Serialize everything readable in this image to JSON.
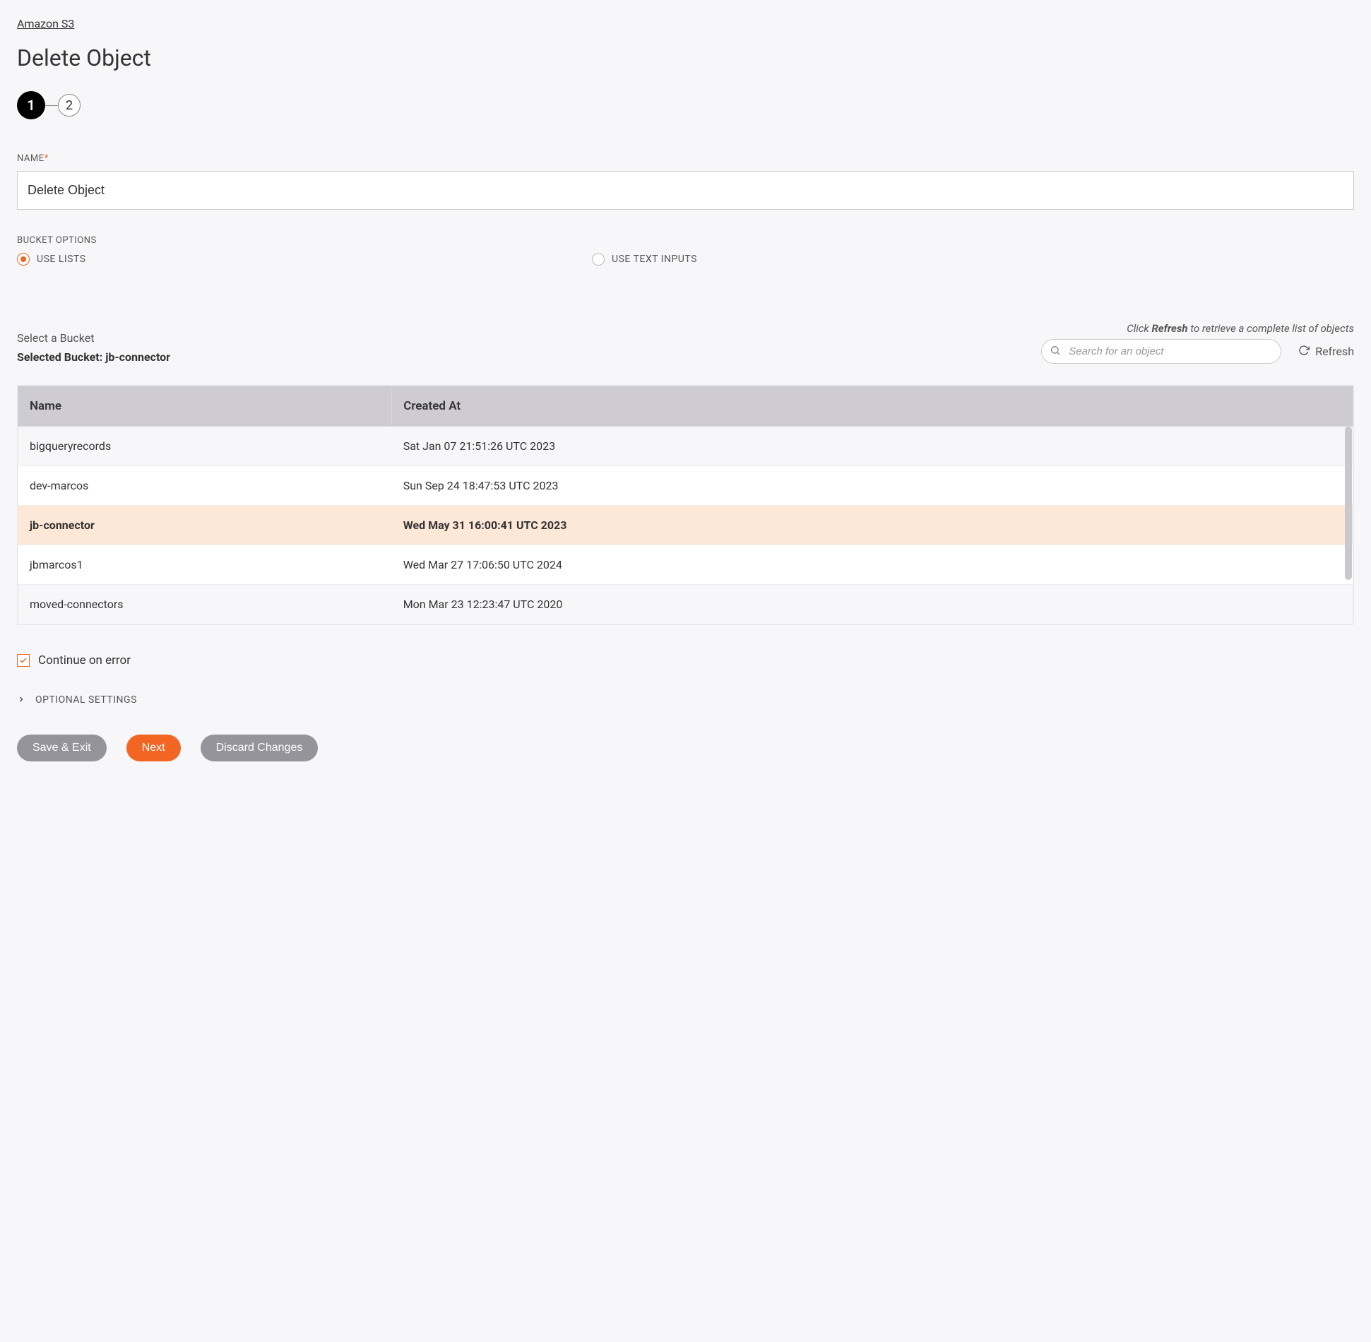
{
  "breadcrumb": "Amazon S3",
  "page_title": "Delete Object",
  "stepper": {
    "step1": "1",
    "step2": "2"
  },
  "name_field": {
    "label": "NAME",
    "value": "Delete Object"
  },
  "bucket_options": {
    "label": "BUCKET OPTIONS",
    "use_lists": "USE LISTS",
    "use_text": "USE TEXT INPUTS"
  },
  "select_bucket_label": "Select a Bucket",
  "selected_bucket_prefix": "Selected Bucket: ",
  "selected_bucket_name": "jb-connector",
  "hint_prefix": "Click ",
  "hint_bold": "Refresh",
  "hint_suffix": " to retrieve a complete list of objects",
  "search": {
    "placeholder": "Search for an object"
  },
  "refresh_label": "Refresh",
  "table": {
    "col_name": "Name",
    "col_created": "Created At",
    "rows": [
      {
        "name": "bigqueryrecords",
        "created": "Sat Jan 07 21:51:26 UTC 2023",
        "selected": false
      },
      {
        "name": "dev-marcos",
        "created": "Sun Sep 24 18:47:53 UTC 2023",
        "selected": false
      },
      {
        "name": "jb-connector",
        "created": "Wed May 31 16:00:41 UTC 2023",
        "selected": true
      },
      {
        "name": "jbmarcos1",
        "created": "Wed Mar 27 17:06:50 UTC 2024",
        "selected": false
      },
      {
        "name": "moved-connectors",
        "created": "Mon Mar 23 12:23:47 UTC 2020",
        "selected": false
      }
    ]
  },
  "continue_on_error": "Continue on error",
  "optional_settings": "OPTIONAL SETTINGS",
  "buttons": {
    "save_exit": "Save & Exit",
    "next": "Next",
    "discard": "Discard Changes"
  }
}
